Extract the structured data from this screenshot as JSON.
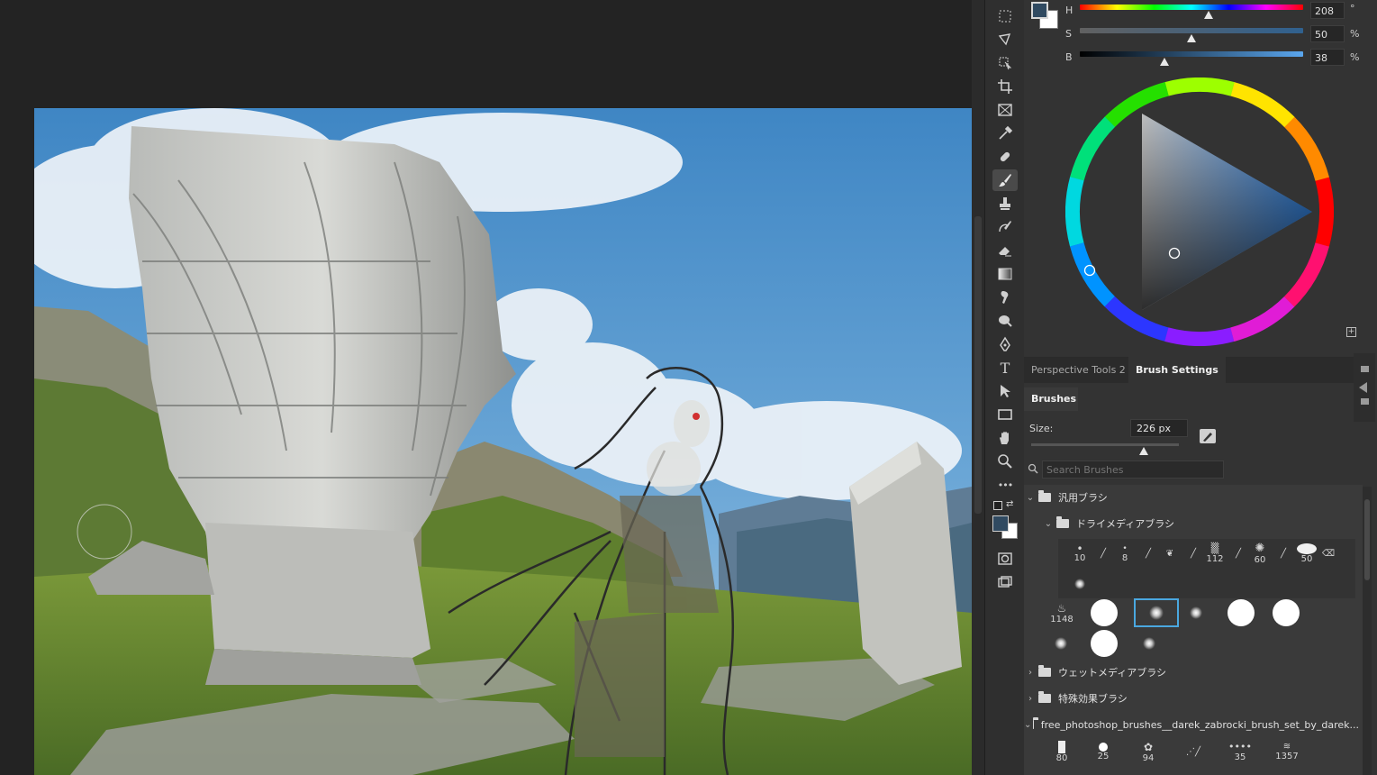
{
  "toolbar": {
    "tools": [
      "marquee-tool",
      "lasso-tool",
      "object-select-tool",
      "crop-tool",
      "frame-tool",
      "eyedropper-tool",
      "healing-brush-tool",
      "brush-tool",
      "clone-stamp-tool",
      "history-brush-tool",
      "eraser-tool",
      "gradient-tool",
      "smudge-tool",
      "dodge-tool",
      "pen-tool",
      "type-tool",
      "path-select-tool",
      "rectangle-tool",
      "hand-tool",
      "zoom-tool",
      "more-tools"
    ],
    "active_tool": "brush-tool",
    "type_glyph": "T",
    "more_glyph": "•••"
  },
  "color_panel": {
    "h_label": "H",
    "s_label": "S",
    "b_label": "B",
    "h_value": "208",
    "s_value": "50",
    "b_value": "38",
    "h_unit": "°",
    "s_unit": "%",
    "b_unit": "%",
    "h_fraction": 0.578,
    "s_fraction": 0.5,
    "b_fraction": 0.38,
    "foreground_color": "#304a61",
    "background_color": "#ffffff"
  },
  "tabs": {
    "perspective": "Perspective Tools 2",
    "brush_settings": "Brush Settings"
  },
  "brushes_panel": {
    "title": "Brushes",
    "size_label": "Size:",
    "size_value": "226 px",
    "size_fraction": 0.76,
    "search_placeholder": "Search Brushes",
    "groups": {
      "general": "汎用ブラシ",
      "dry_media": "ドライメディアブラシ",
      "wet_media": "ウェットメディアブラシ",
      "special_fx": "特殊効果ブラシ",
      "free_set": "free_photoshop_brushes__darek_zabrocki_brush_set_by_darek..."
    },
    "dry_sizes": [
      "10",
      "8",
      "112",
      "60",
      "50"
    ],
    "general_sizes": [
      "1148"
    ],
    "free_sizes": [
      "80",
      "25",
      "94",
      "35",
      "1357"
    ]
  },
  "colors": {
    "panel_bg": "#333333",
    "selected_outline": "#4aa8e0"
  }
}
